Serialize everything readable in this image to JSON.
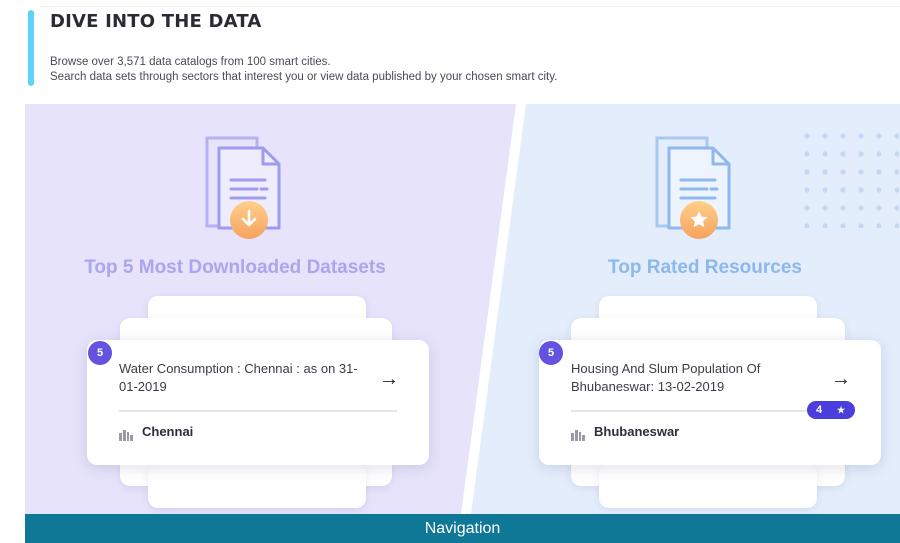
{
  "header": {
    "title": "DIVE INTO THE DATA",
    "desc_line1": "Browse over 3,571 data catalogs from 100 smart cities.",
    "desc_line2": "Search data sets through sectors that interest you or view data published by your chosen smart city."
  },
  "left_card": {
    "title": "Top 5 Most Downloaded Datasets",
    "icon": "download-document-icon",
    "index": "5",
    "item_name": "Water Consumption : Chennai : as on 31-01-2019",
    "city": "Chennai"
  },
  "right_card": {
    "title": "Top Rated Resources",
    "icon": "star-document-icon",
    "index": "5",
    "item_name": "Housing And Slum Population Of Bhubaneswar: 13-02-2019",
    "rating": "4",
    "rating_star": "★",
    "city": "Bhubaneswar"
  },
  "arrow_symbol": "→",
  "footer": {
    "label": "Navigation"
  },
  "colors": {
    "accent_bar": "#5fd3f5",
    "left_bg": "#e6e3fb",
    "right_bg": "#e3edfb",
    "badge": "#6353e0",
    "nav_bg": "#0f7896"
  }
}
